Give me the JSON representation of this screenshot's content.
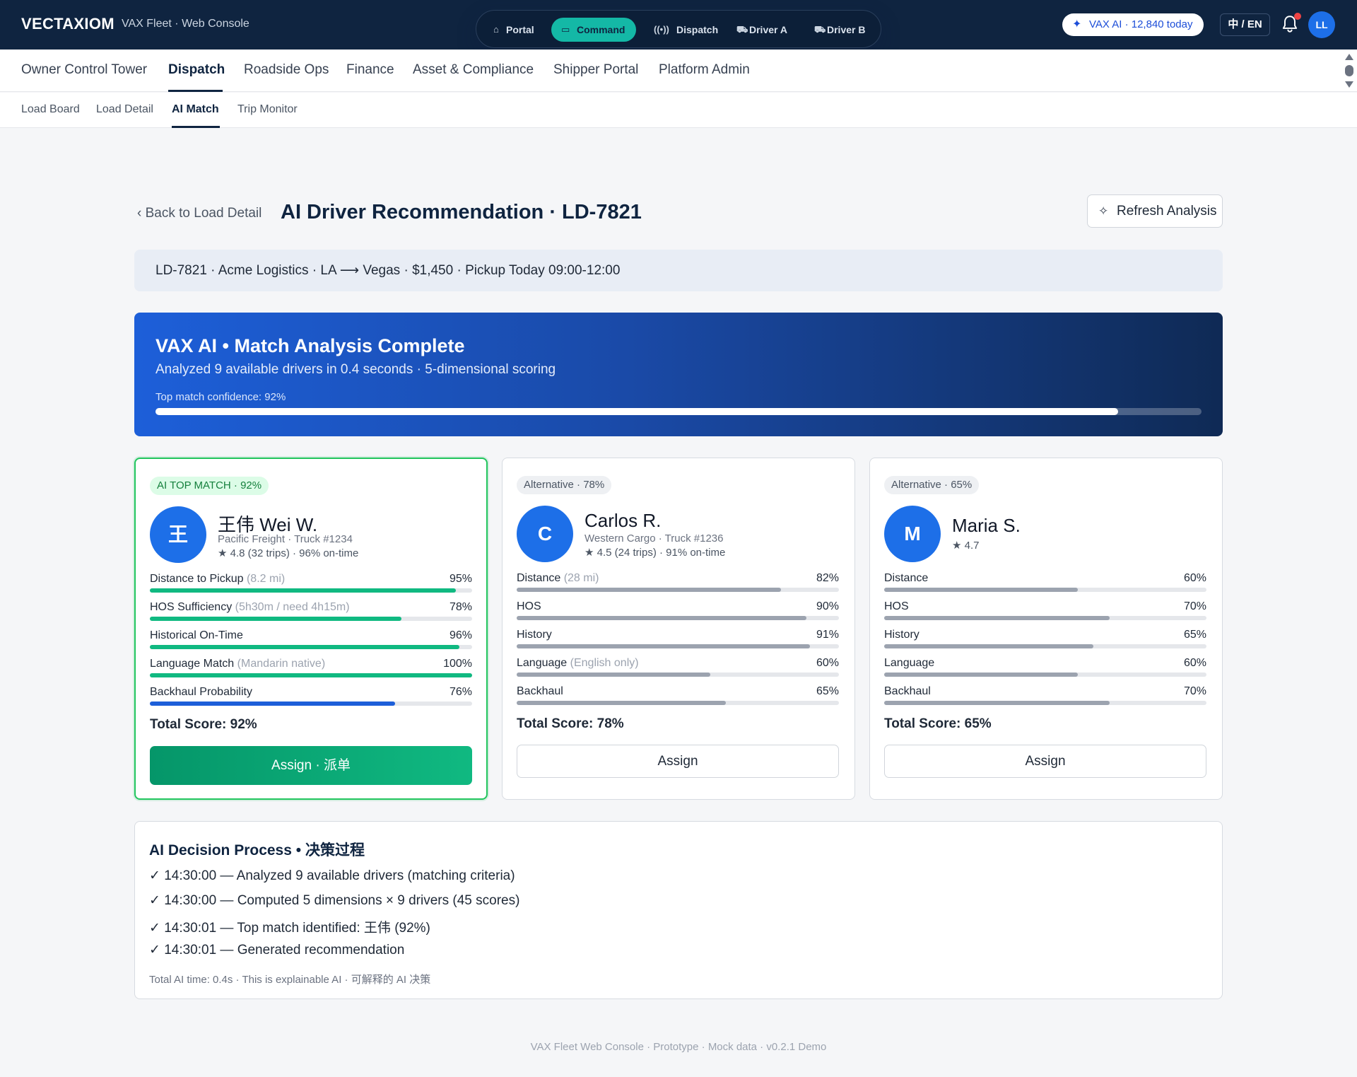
{
  "topbar": {
    "brand": "VECTAXIOM",
    "subtitle": "VAX Fleet · Web Console",
    "switcher": [
      {
        "label": "Portal",
        "icon": "home-icon"
      },
      {
        "label": "Command",
        "icon": "monitor-icon",
        "active": true
      },
      {
        "label": "Dispatch",
        "icon": "broadcast-icon"
      },
      {
        "label": "Driver A",
        "icon": "truck-icon"
      },
      {
        "label": "Driver B",
        "icon": "truck-icon"
      }
    ],
    "ai_pill": "VAX AI · 12,840 today",
    "lang": "中 / EN",
    "avatar": "LL"
  },
  "nav_primary": [
    {
      "label": "Owner Control Tower"
    },
    {
      "label": "Dispatch",
      "active": true
    },
    {
      "label": "Roadside Ops"
    },
    {
      "label": "Finance"
    },
    {
      "label": "Asset & Compliance"
    },
    {
      "label": "Shipper Portal"
    },
    {
      "label": "Platform Admin"
    }
  ],
  "nav_secondary": [
    {
      "label": "Load Board"
    },
    {
      "label": "Load Detail"
    },
    {
      "label": "AI Match",
      "active": true
    },
    {
      "label": "Trip Monitor"
    }
  ],
  "header": {
    "back": "Back to Load Detail",
    "title": "AI Driver Recommendation · LD-7821",
    "refresh": "Refresh Analysis"
  },
  "load_summary": "LD-7821 · Acme Logistics · LA ⟶ Vegas · $1,450 · Pickup Today 09:00-12:00",
  "banner": {
    "title": "VAX AI • Match Analysis Complete",
    "subtitle": "Analyzed 9 available drivers in 0.4 seconds · 5-dimensional scoring",
    "confidence_label": "Top match confidence: 92%",
    "confidence": 0.92
  },
  "candidates": [
    {
      "tag": "AI TOP MATCH · 92%",
      "initial": "王",
      "name": "王伟 Wei W.",
      "meta": "Pacific Freight · Truck #1234",
      "stats": "★ 4.8 (32 trips) · 96% on-time",
      "metrics": [
        {
          "label": "Distance to Pickup",
          "note": "(8.2 mi)",
          "pct": "95%",
          "value": 0.95,
          "color": "#10b981"
        },
        {
          "label": "HOS Sufficiency",
          "note": "(5h30m / need 4h15m)",
          "pct": "78%",
          "value": 0.78,
          "color": "#10b981"
        },
        {
          "label": "Historical On-Time",
          "note": "",
          "pct": "96%",
          "value": 0.96,
          "color": "#10b981"
        },
        {
          "label": "Language Match",
          "note": "(Mandarin native)",
          "pct": "100%",
          "value": 1.0,
          "color": "#10b981"
        },
        {
          "label": "Backhaul Probability",
          "note": "",
          "pct": "76%",
          "value": 0.76,
          "color": "#1d5fd9"
        }
      ],
      "total": "Total Score: 92%",
      "assign": "Assign · 派单"
    },
    {
      "tag": "Alternative · 78%",
      "initial": "C",
      "name": "Carlos R.",
      "meta": "Western Cargo · Truck #1236",
      "stats": "★ 4.5 (24 trips) · 91% on-time",
      "metrics": [
        {
          "label": "Distance",
          "note": "(28 mi)",
          "pct": "82%",
          "value": 0.82,
          "color": "#9ca3af"
        },
        {
          "label": "HOS",
          "note": "",
          "pct": "90%",
          "value": 0.9,
          "color": "#9ca3af"
        },
        {
          "label": "History",
          "note": "",
          "pct": "91%",
          "value": 0.91,
          "color": "#9ca3af"
        },
        {
          "label": "Language",
          "note": "(English only)",
          "pct": "60%",
          "value": 0.6,
          "color": "#9ca3af"
        },
        {
          "label": "Backhaul",
          "note": "",
          "pct": "65%",
          "value": 0.65,
          "color": "#9ca3af"
        }
      ],
      "total": "Total Score: 78%",
      "assign": "Assign"
    },
    {
      "tag": "Alternative · 65%",
      "initial": "M",
      "name": "Maria S.",
      "meta": "",
      "stats": "★ 4.7",
      "metrics": [
        {
          "label": "Distance",
          "note": "",
          "pct": "60%",
          "value": 0.6,
          "color": "#9ca3af"
        },
        {
          "label": "HOS",
          "note": "",
          "pct": "70%",
          "value": 0.7,
          "color": "#9ca3af"
        },
        {
          "label": "History",
          "note": "",
          "pct": "65%",
          "value": 0.65,
          "color": "#9ca3af"
        },
        {
          "label": "Language",
          "note": "",
          "pct": "60%",
          "value": 0.6,
          "color": "#9ca3af"
        },
        {
          "label": "Backhaul",
          "note": "",
          "pct": "70%",
          "value": 0.7,
          "color": "#9ca3af"
        }
      ],
      "total": "Total Score: 65%",
      "assign": "Assign"
    }
  ],
  "decision": {
    "title": "AI Decision Process • 决策过程",
    "steps": [
      "✓ 14:30:00 — Analyzed 9 available drivers (matching criteria)",
      "✓ 14:30:00 — Computed 5 dimensions × 9 drivers (45 scores)",
      "✓ 14:30:01 — Top match identified: 王伟 (92%)",
      "✓ 14:30:01 — Generated recommendation"
    ],
    "footnote": "Total AI time: 0.4s · This is explainable AI · 可解释的 AI 决策"
  },
  "footer": "VAX Fleet Web Console · Prototype · Mock data · v0.2.1 Demo"
}
